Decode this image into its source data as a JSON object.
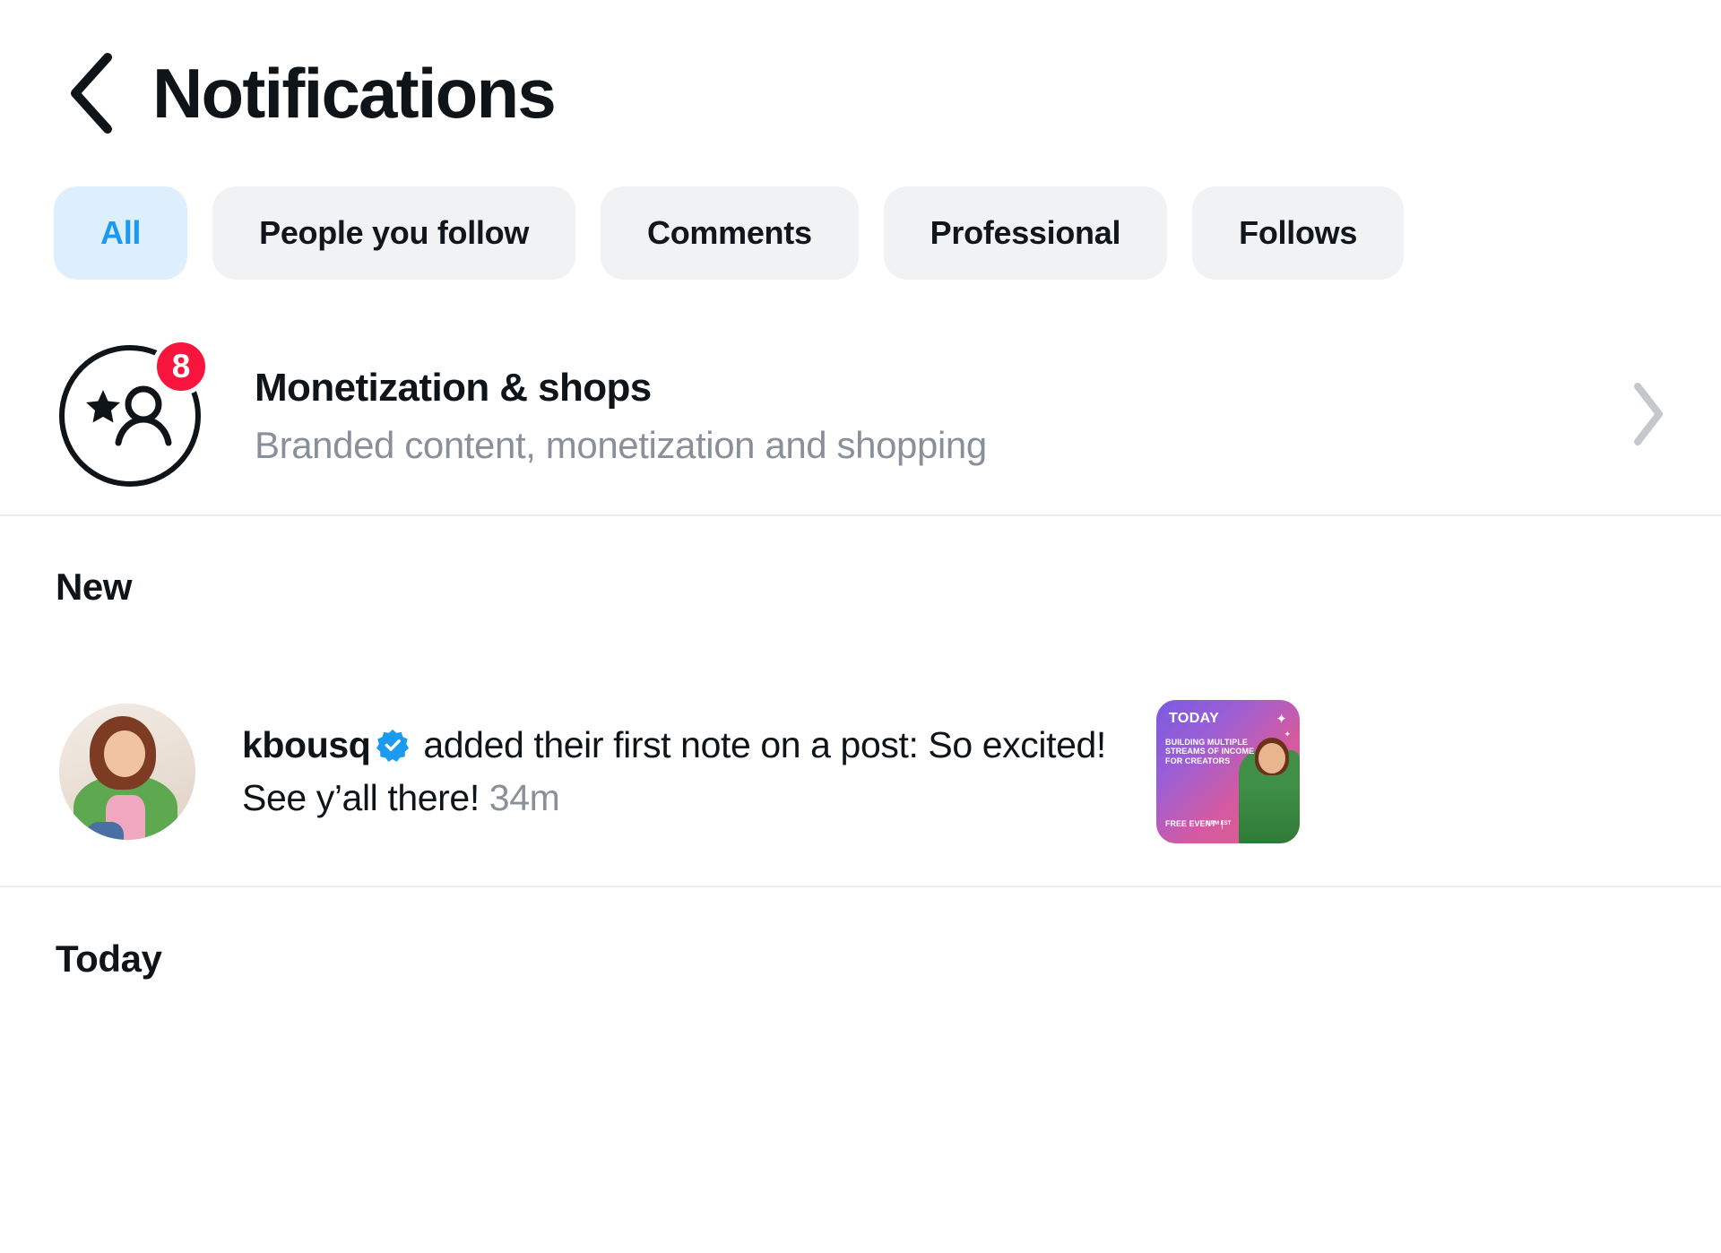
{
  "header": {
    "title": "Notifications",
    "back_icon": "chevron-left-icon"
  },
  "filters": {
    "tabs": [
      {
        "label": "All",
        "active": true
      },
      {
        "label": "People you follow",
        "active": false
      },
      {
        "label": "Comments",
        "active": false
      },
      {
        "label": "Professional",
        "active": false
      },
      {
        "label": "Follows",
        "active": false
      }
    ],
    "active_color": "#1a9bf0",
    "active_bg": "#ddeffc",
    "inactive_bg": "#f1f2f4"
  },
  "monetization": {
    "icon": "star-person-icon",
    "badge_count": "8",
    "badge_color": "#f8143c",
    "title": "Monetization & shops",
    "subtitle": "Branded content, monetization and shopping",
    "chevron": "chevron-right-icon"
  },
  "sections": {
    "new_label": "New",
    "today_label": "Today"
  },
  "notification": {
    "avatar": "user-avatar",
    "username": "kbousq",
    "verified_icon": "verified-badge-icon",
    "verified_color": "#1a9bf0",
    "body": " added their first note on a post: So excited! See y’all there! ",
    "time": "34m",
    "thumbnail": {
      "name": "post-thumbnail",
      "today_label": "TODAY",
      "line1": "BUILDING MULTIPLE",
      "line2": "STREAMS OF INCOME",
      "line3": "FOR CREATORS",
      "free_label": "FREE\nEVENT",
      "time_label": "1\nPM EST"
    }
  }
}
